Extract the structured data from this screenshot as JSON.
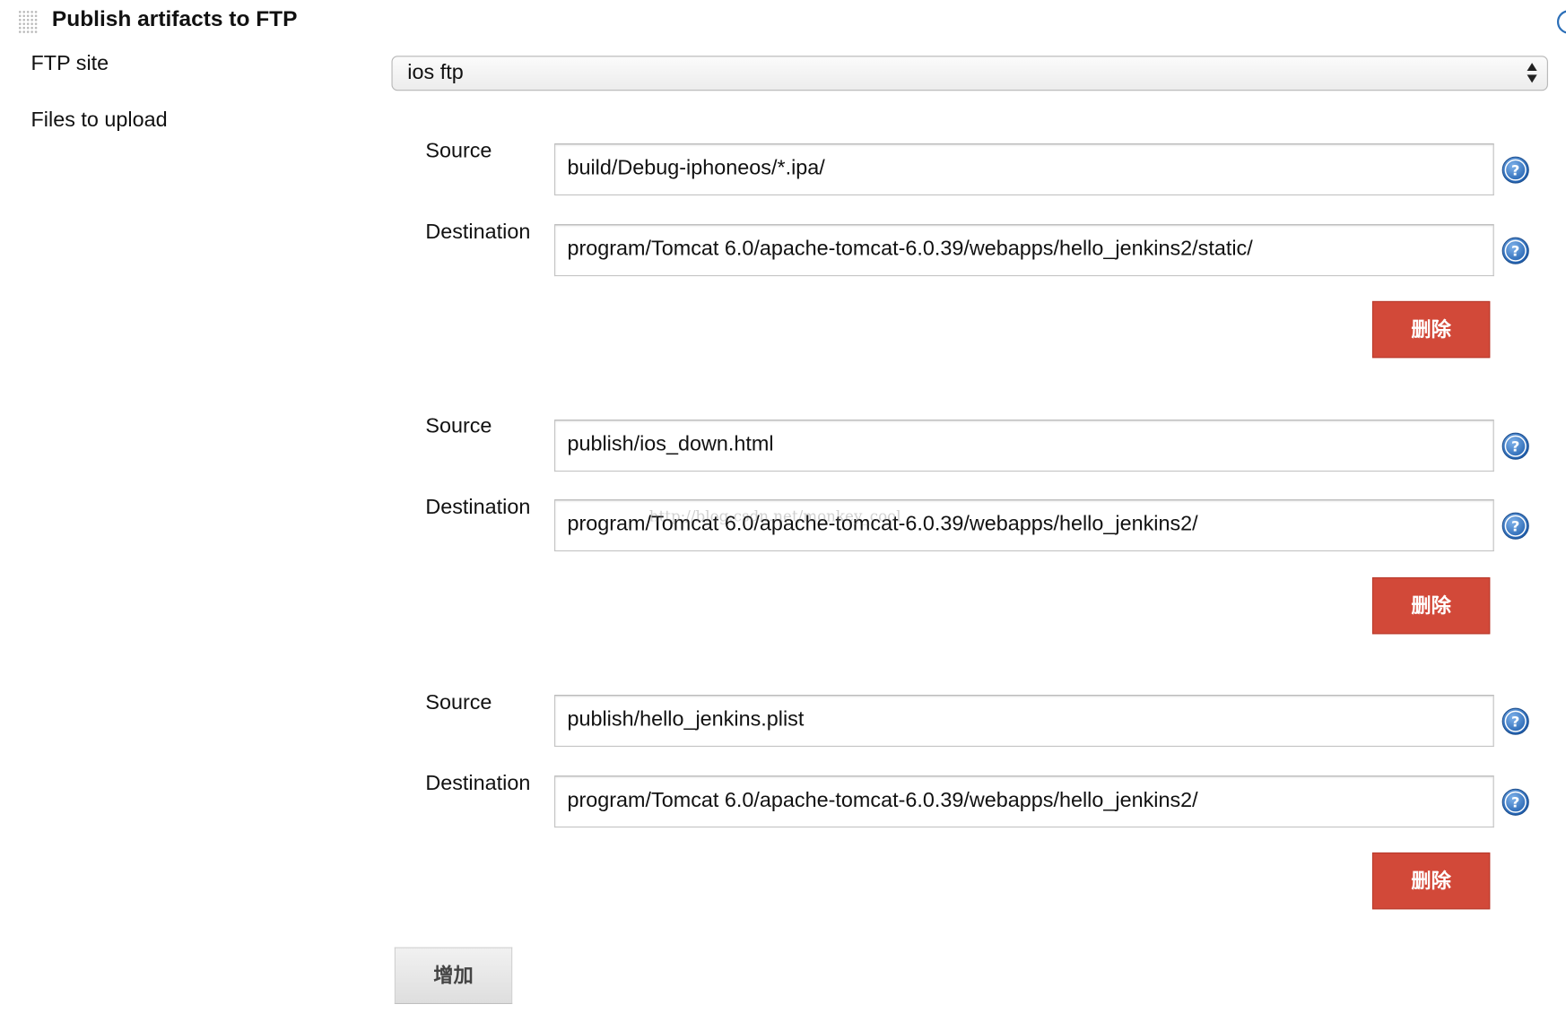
{
  "section": {
    "title": "Publish artifacts to FTP"
  },
  "ftp_site": {
    "label": "FTP site",
    "selected": "ios ftp"
  },
  "files_to_upload": {
    "label": "Files to upload",
    "entries": [
      {
        "source_label": "Source",
        "source_value": "build/Debug-iphoneos/*.ipa/",
        "destination_label": "Destination",
        "destination_value": "program/Tomcat 6.0/apache-tomcat-6.0.39/webapps/hello_jenkins2/static/",
        "delete_label": "删除"
      },
      {
        "source_label": "Source",
        "source_value": "publish/ios_down.html",
        "destination_label": "Destination",
        "destination_value": "program/Tomcat 6.0/apache-tomcat-6.0.39/webapps/hello_jenkins2/",
        "delete_label": "删除"
      },
      {
        "source_label": "Source",
        "source_value": "publish/hello_jenkins.plist",
        "destination_label": "Destination",
        "destination_value": "program/Tomcat 6.0/apache-tomcat-6.0.39/webapps/hello_jenkins2/",
        "delete_label": "删除"
      }
    ],
    "add_label": "增加"
  },
  "watermark": "http://blog.csdn.net/monkey_cool",
  "icons": {
    "help": "help-icon",
    "drag": "drag-handle-icon",
    "dropdown": "select-arrows-icon"
  },
  "colors": {
    "delete_button": "#d24939",
    "help_icon": "#2c6fb8",
    "add_button": "#e6e6e6"
  }
}
